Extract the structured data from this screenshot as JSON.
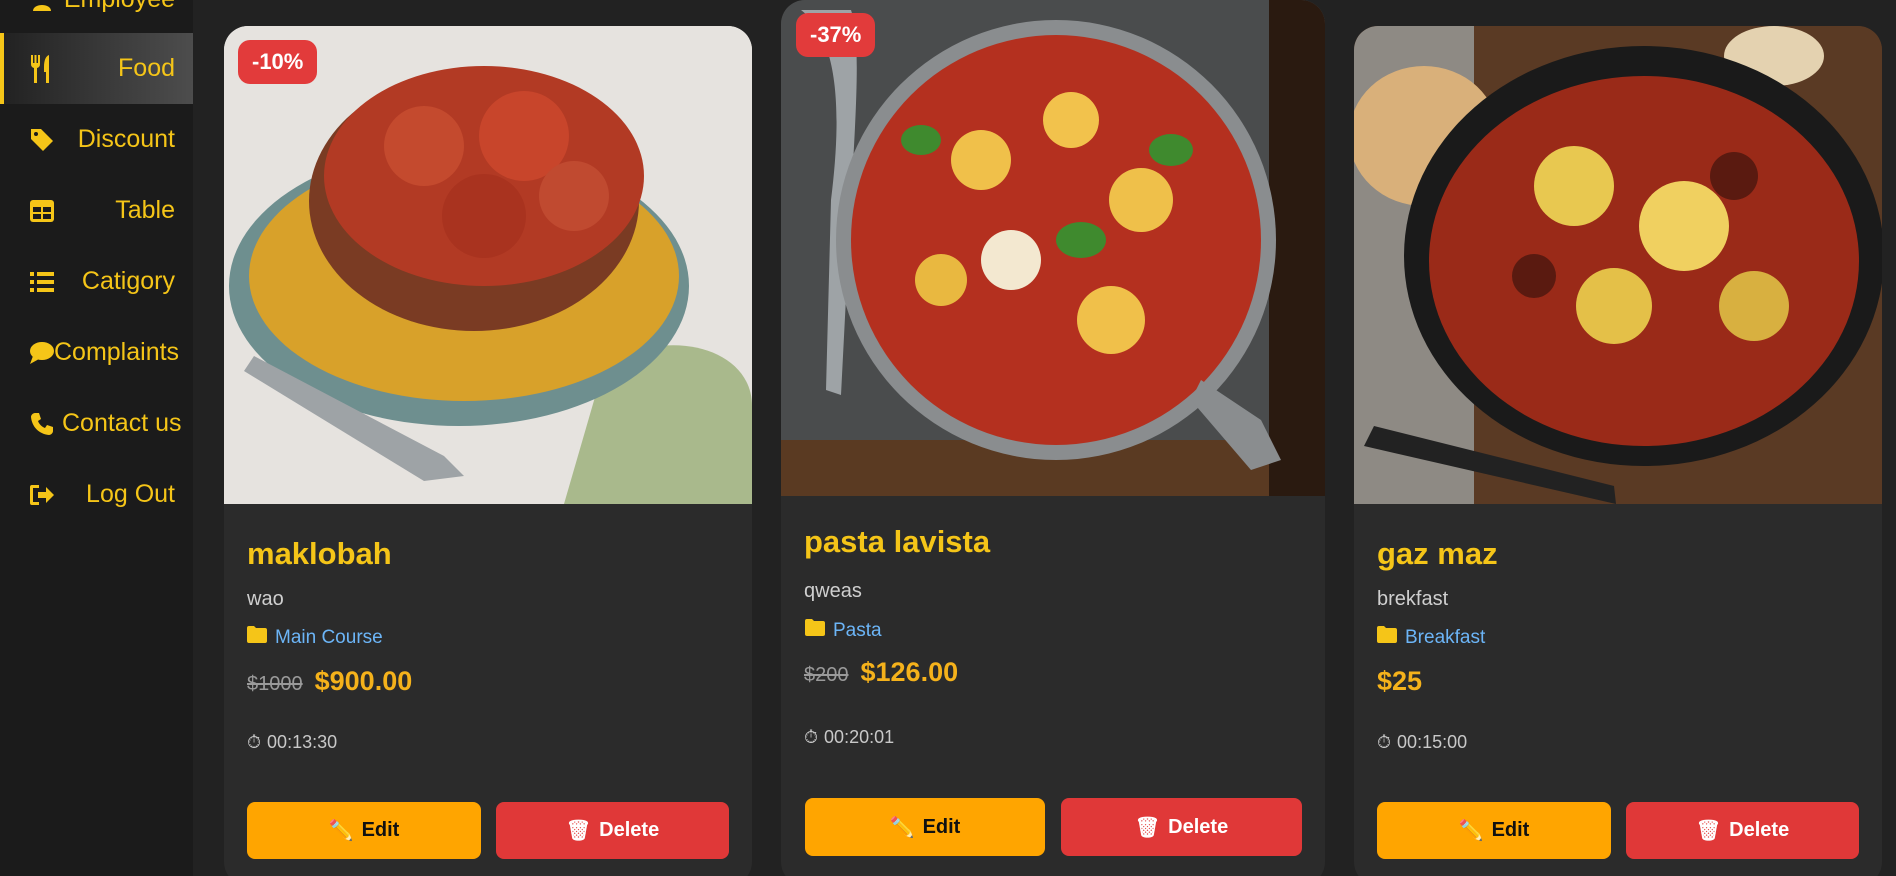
{
  "sidebar": {
    "items": [
      {
        "label": "Employee",
        "icon": "user-icon"
      },
      {
        "label": "Food",
        "icon": "utensils-icon",
        "active": true
      },
      {
        "label": "Discount",
        "icon": "tag-icon"
      },
      {
        "label": "Table",
        "icon": "table-icon"
      },
      {
        "label": "Catigory",
        "icon": "list-icon"
      },
      {
        "label": "Complaints",
        "icon": "comment-icon"
      },
      {
        "label": "Contact us",
        "icon": "phone-icon"
      },
      {
        "label": "Log Out",
        "icon": "logout-icon"
      }
    ]
  },
  "cards": [
    {
      "badge": "-10%",
      "title": "maklobah",
      "description": "wao",
      "category": "Main Course",
      "old_price": "$1000",
      "price": "$900.00",
      "timer": "00:13:30",
      "edit_label": "Edit",
      "delete_label": "Delete"
    },
    {
      "badge": "-37%",
      "title": "pasta lavista",
      "description": "qweas",
      "category": "Pasta",
      "old_price": "$200",
      "price": "$126.00",
      "timer": "00:20:01",
      "edit_label": "Edit",
      "delete_label": "Delete"
    },
    {
      "title": "gaz maz",
      "description": "brekfast",
      "category": "Breakfast",
      "price": "$25",
      "timer": "00:15:00",
      "edit_label": "Edit",
      "delete_label": "Delete"
    }
  ],
  "colors": {
    "accent": "#f5c518",
    "price": "#f5b21b",
    "edit": "#ffa500",
    "delete": "#e03838",
    "category_link": "#6cb5f7",
    "card_bg": "#2b2b2b"
  }
}
